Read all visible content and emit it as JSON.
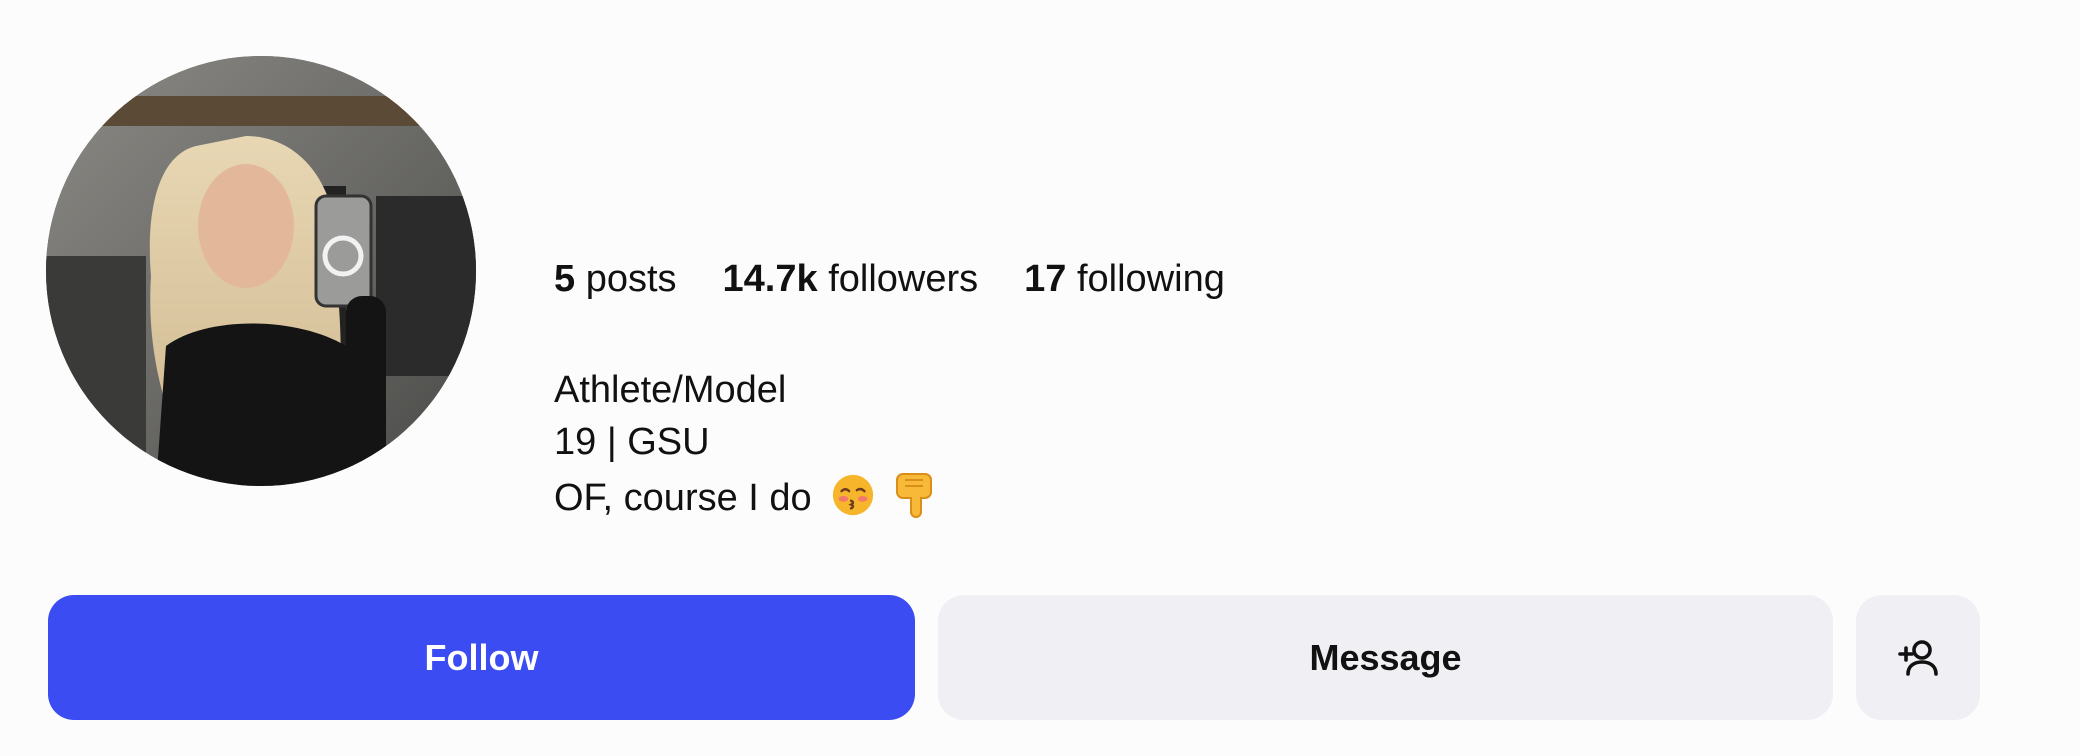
{
  "profile": {
    "avatar_alt": "profile photo",
    "stats": {
      "posts_count": "5",
      "posts_label": "posts",
      "followers_count": "14.7k",
      "followers_label": "followers",
      "following_count": "17",
      "following_label": "following"
    },
    "bio": {
      "line1": "Athlete/Model",
      "line2": "19 | GSU",
      "line3": "OF, course I do",
      "emoji1": "kissing-face-with-closed-eyes",
      "emoji2": "backhand-index-pointing-down"
    }
  },
  "actions": {
    "follow_label": "Follow",
    "message_label": "Message",
    "add_user_icon": "add-user-icon"
  },
  "colors": {
    "follow_bg": "#3b4cf3",
    "secondary_bg": "#efeff4",
    "page_bg": "#fdfcfd"
  }
}
